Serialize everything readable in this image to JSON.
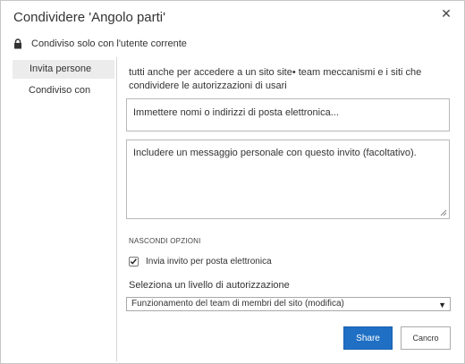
{
  "dialog": {
    "title": "Condividere 'Angolo parti'",
    "close_icon": "close-icon"
  },
  "sharing_status": {
    "icon": "lock-icon",
    "text": "Condiviso solo con l'utente corrente"
  },
  "sidebar": {
    "items": [
      {
        "label": "Invita persone",
        "active": true
      },
      {
        "label": "Condiviso con",
        "active": false
      }
    ]
  },
  "invite": {
    "info_text": "tutti anche per accedere a un sito site• team meccanismi e i siti che condividere le autorizzazioni di usari",
    "people_placeholder": "Immettere nomi o indirizzi di posta elettronica...",
    "message_placeholder": "Includere un messaggio personale con questo invito (facoltativo)."
  },
  "options": {
    "hide_options_label": "NASCONDI OPZIONI",
    "send_email_label": "Invia invito per posta elettronica",
    "send_email_checked": true,
    "permission_label": "Seleziona un livello di autorizzazione",
    "permission_value": "Funzionamento del team di membri del sito (modifica)"
  },
  "buttons": {
    "share_label": "Share",
    "cancel_label": "Cancro"
  },
  "colors": {
    "primary_button": "#1f6fc5",
    "sidebar_active_bg": "#ececec"
  }
}
